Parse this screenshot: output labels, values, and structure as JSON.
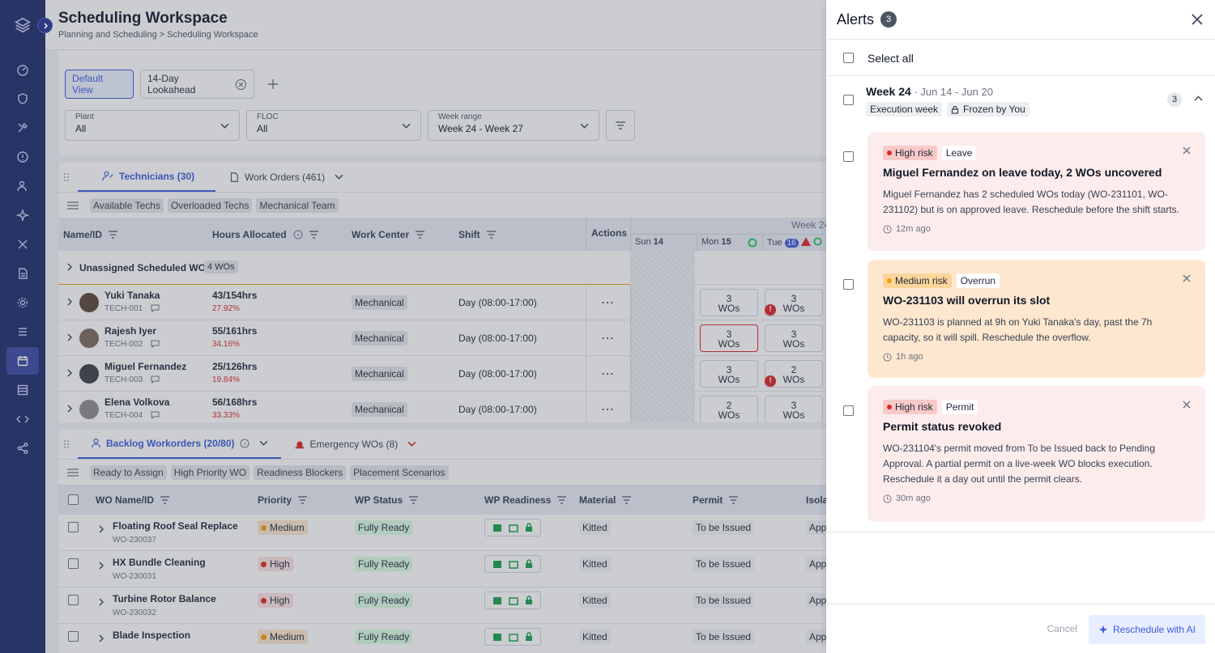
{
  "sidebar": {
    "icons": [
      "logo-icon",
      "dashboard-icon",
      "shield-icon",
      "tools-icon",
      "info-icon",
      "users-icon",
      "sparkle-icon",
      "wrench-icon",
      "document-icon",
      "gear-icon",
      "list-icon",
      "calendar-icon",
      "table-icon",
      "code-icon",
      "share-icon"
    ],
    "active_index": 11
  },
  "header": {
    "title": "Scheduling Workspace",
    "crumb1": "Planning and Scheduling",
    "crumb_sep": ">",
    "crumb2": "Scheduling Workspace"
  },
  "views": {
    "default": "Default View",
    "lookahead": "14-Day Lookahead"
  },
  "filters": {
    "plant": {
      "label": "Plant",
      "value": "All"
    },
    "floc": {
      "label": "FLOC",
      "value": "All"
    },
    "week": {
      "label": "Week range",
      "value": "Week 24 - Week 27"
    }
  },
  "tech_panel": {
    "tab_tech": "Technicians (30)",
    "tab_wo": "Work Orders (461)",
    "chips": [
      "Available Techs",
      "Overloaded Techs",
      "Mechanical Team"
    ],
    "cols": {
      "name": "Name/ID",
      "hours": "Hours Allocated",
      "wc": "Work Center",
      "shift": "Shift",
      "actions": "Actions"
    },
    "week_label": "Week 24",
    "days": {
      "sun": "Sun",
      "sun_n": "14",
      "mon": "Mon",
      "mon_n": "15",
      "tue": "Tue",
      "tue_n": "16"
    },
    "unassigned": {
      "label": "Unassigned Scheduled WO",
      "count": "4 WOs"
    },
    "rows": [
      {
        "name": "Yuki Tanaka",
        "id": "TECH-001",
        "hours": "43/154hrs",
        "pct": "27.92%",
        "wc": "Mechanical",
        "shift": "Day (08:00-17:00)",
        "mon_n": "3",
        "mon_u": "WOs",
        "tue_n": "3",
        "tue_u": "WOs"
      },
      {
        "name": "Rajesh Iyer",
        "id": "TECH-002",
        "hours": "55/161hrs",
        "pct": "34.16%",
        "wc": "Mechanical",
        "shift": "Day (08:00-17:00)",
        "mon_n": "3",
        "mon_u": "WOs",
        "tue_n": "3",
        "tue_u": "WOs"
      },
      {
        "name": "Miguel Fernandez",
        "id": "TECH-003",
        "hours": "25/126hrs",
        "pct": "19.84%",
        "wc": "Mechanical",
        "shift": "Day (08:00-17:00)",
        "mon_n": "3",
        "mon_u": "WOs",
        "tue_n": "2",
        "tue_u": "WOs"
      },
      {
        "name": "Elena Volkova",
        "id": "TECH-004",
        "hours": "56/168hrs",
        "pct": "33.33%",
        "wc": "Mechanical",
        "shift": "Day (08:00-17:00)",
        "mon_n": "2",
        "mon_u": "WOs",
        "tue_n": "3",
        "tue_u": "WOs"
      }
    ]
  },
  "backlog_panel": {
    "tab_backlog": "Backlog Workorders (20/80)",
    "tab_emergency": "Emergency WOs (8)",
    "chips": [
      "Ready to Assign",
      "High Priority WO",
      "Readiness Blockers",
      "Placement Scenarios"
    ],
    "cols": {
      "name": "WO Name/ID",
      "priority": "Priority",
      "wp_status": "WP Status",
      "wp_readiness": "WP Readiness",
      "material": "Material",
      "permit": "Permit",
      "isolation": "Isola"
    },
    "rows": [
      {
        "name": "Floating Roof Seal Replace",
        "id": "WO-230037",
        "priority": "Medium",
        "status": "Fully Ready",
        "material": "Kitted",
        "permit": "To be Issued",
        "iso": "App"
      },
      {
        "name": "HX Bundle Cleaning",
        "id": "WO-230031",
        "priority": "High",
        "status": "Fully Ready",
        "material": "Kitted",
        "permit": "To be Issued",
        "iso": "App"
      },
      {
        "name": "Turbine Rotor Balance",
        "id": "WO-230032",
        "priority": "High",
        "status": "Fully Ready",
        "material": "Kitted",
        "permit": "To be Issued",
        "iso": "App"
      },
      {
        "name": "Blade Inspection",
        "id": "",
        "priority": "Medium",
        "status": "Fully Ready",
        "material": "Kitted",
        "permit": "To be Issued",
        "iso": "App"
      }
    ]
  },
  "alerts": {
    "title": "Alerts",
    "count": "3",
    "select_all": "Select all",
    "week": {
      "title": "Week 24",
      "range": "· Jun 14 - Jun 20",
      "tag1": "Execution week",
      "tag2": "Frozen by You",
      "count": "3"
    },
    "items": [
      {
        "risk": "High risk",
        "type": "Leave",
        "title": "Miguel Fernandez on leave today, 2 WOs uncovered",
        "desc": "Miguel Fernandez has 2 scheduled WOs today (WO-231101, WO-231102) but is on approved leave. Reschedule before the shift starts.",
        "time": "12m ago"
      },
      {
        "risk": "Medium risk",
        "type": "Overrun",
        "title": "WO-231103 will overrun its slot",
        "desc": "WO-231103 is planned at 9h on Yuki Tanaka's day, past the 7h capacity, so it will spill. Reschedule the overflow.",
        "time": "1h ago"
      },
      {
        "risk": "High risk",
        "type": "Permit",
        "title": "Permit status revoked",
        "desc": "WO-231104's permit moved from To be Issued back to Pending Approval. A partial permit on a live-week WO blocks execution. Reschedule it a day out until the permit clears.",
        "time": "30m ago"
      }
    ],
    "cancel": "Cancel",
    "reschedule": "Reschedule with AI"
  },
  "colors": {
    "accent": "#3b5bdb",
    "sidebar": "#1e2a6b",
    "high": "#fdecec",
    "medium": "#fde7cf",
    "danger": "#dc2626"
  }
}
